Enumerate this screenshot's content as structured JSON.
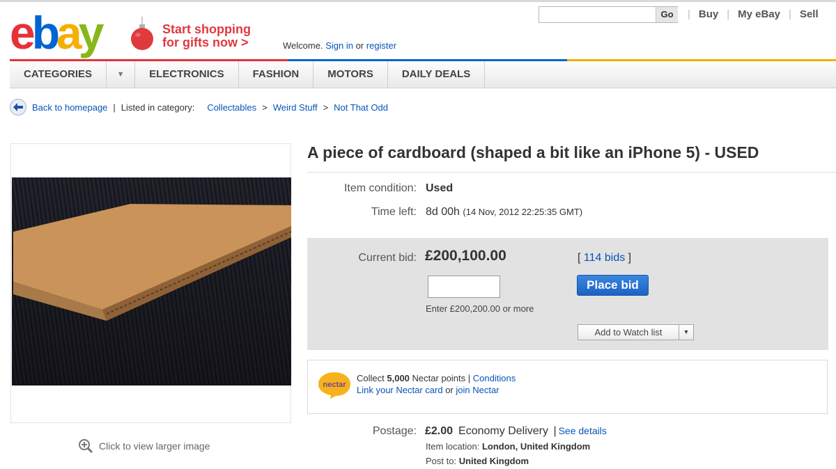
{
  "header": {
    "logo": {
      "letters": [
        "e",
        "b",
        "a",
        "y"
      ],
      "colors": [
        "#e53238",
        "#0064d2",
        "#f5af02",
        "#86b817"
      ]
    },
    "promo_line1": "Start shopping",
    "promo_line2": "for gifts now >",
    "welcome": "Welcome.",
    "sign_in": "Sign in",
    "or": "or",
    "register": "register",
    "search_button": "Go",
    "links": [
      "Buy",
      "My eBay",
      "Sell"
    ]
  },
  "nav": {
    "items": [
      "CATEGORIES",
      "ELECTRONICS",
      "FASHION",
      "MOTORS",
      "DAILY DEALS"
    ],
    "caret_icon": "chevron-down-icon"
  },
  "breadcrumb": {
    "back": "Back to homepage",
    "sep": "|",
    "listed_in": "Listed in category:",
    "categories": [
      "Collectables",
      "Weird Stuff",
      "Not That Odd"
    ],
    "arrow": ">"
  },
  "item": {
    "title": "A piece of cardboard (shaped a bit like an iPhone 5) - USED",
    "condition_label": "Item condition:",
    "condition": "Used",
    "time_left_label": "Time left:",
    "time_left": "8d 00h",
    "end_time": "(14 Nov, 2012  22:25:35 GMT)",
    "zoom_text": "Click to view larger image"
  },
  "bid": {
    "current_label": "Current bid:",
    "current_value": "£200,100.00",
    "bids_open": "[",
    "bids_link": "114 bids",
    "bids_close": "]",
    "place_bid": "Place bid",
    "hint": "Enter £200,200.00 or more",
    "watch": "Add to Watch list"
  },
  "nectar": {
    "logo_text": "nectar",
    "collect": "Collect",
    "points": "5,000",
    "points_suffix": "Nectar points |",
    "conditions": "Conditions",
    "link_card": "Link your Nectar card",
    "or": "or",
    "join": "join Nectar"
  },
  "postage": {
    "label": "Postage:",
    "price": "£2.00",
    "method": "Economy Delivery",
    "sep": "|",
    "details": "See details",
    "location_label": "Item location:",
    "location": "London, United Kingdom",
    "post_to_label": "Post to:",
    "post_to": "United Kingdom"
  }
}
